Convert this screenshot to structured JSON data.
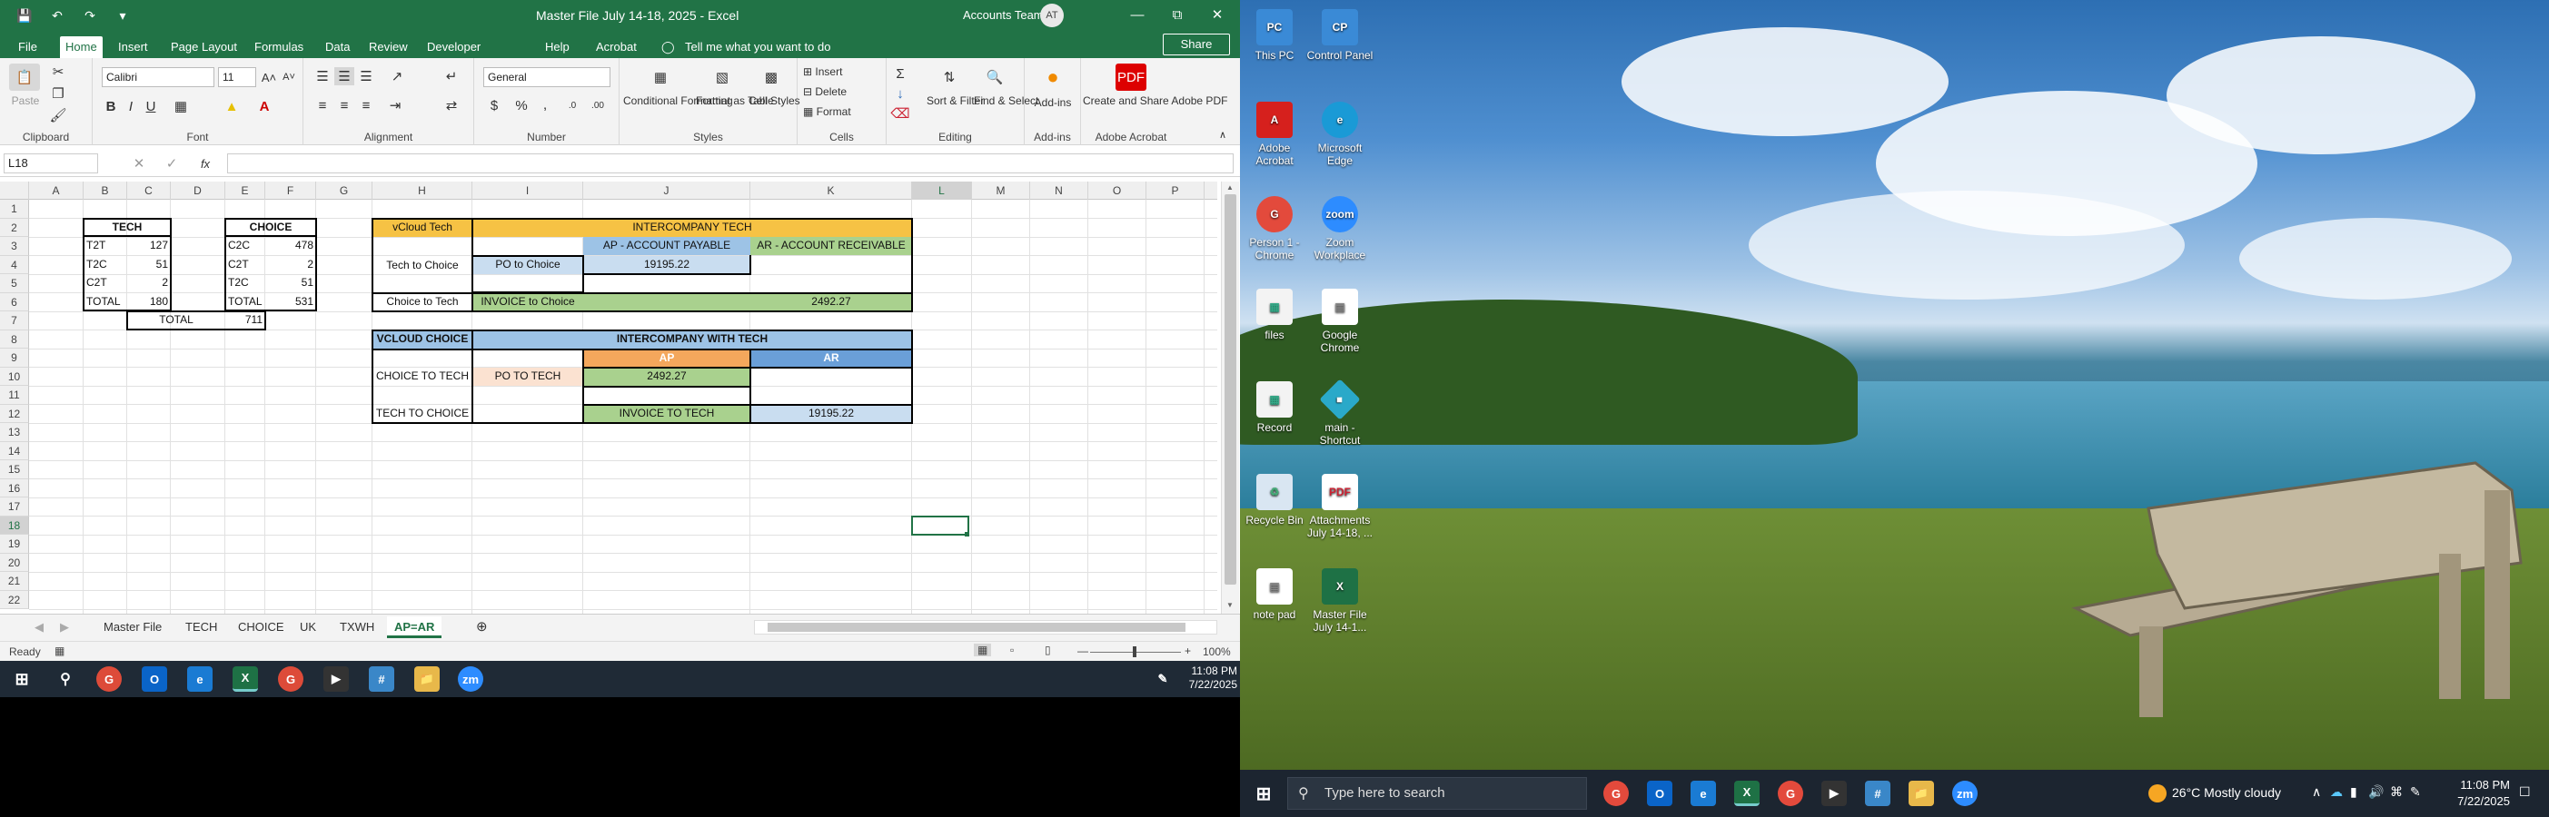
{
  "excel": {
    "title": "Master File July 14-18, 2025  -  Excel",
    "account": "Accounts Team",
    "avatar_initials": "AT",
    "share": "Share",
    "ribbon_tabs": [
      "File",
      "Home",
      "Insert",
      "Page Layout",
      "Formulas",
      "Data",
      "Review",
      "Developer",
      "Help",
      "Acrobat"
    ],
    "tell_me": "Tell me what you want to do",
    "ribbon": {
      "paste": "Paste",
      "clipboard": "Clipboard",
      "font_name": "Calibri",
      "font_size": "11",
      "font": "Font",
      "alignment": "Alignment",
      "number_format": "General",
      "number": "Number",
      "conditional": "Conditional Formatting",
      "format_table": "Format as Table",
      "cell_styles": "Cell Styles",
      "styles": "Styles",
      "insert": "Insert",
      "delete": "Delete",
      "format": "Format",
      "cells": "Cells",
      "sort_filter": "Sort & Filter",
      "find_select": "Find & Select",
      "editing": "Editing",
      "addins": "Add-ins",
      "addins_group": "Add-ins",
      "create_share": "Create and Share Adobe PDF",
      "adobe_acrobat": "Adobe Acrobat"
    },
    "name_box": "L18",
    "fx": "fx",
    "columns": [
      "A",
      "B",
      "C",
      "D",
      "E",
      "F",
      "G",
      "H",
      "I",
      "J",
      "K",
      "L",
      "M",
      "N",
      "O",
      "P"
    ],
    "rows": [
      "1",
      "2",
      "3",
      "4",
      "5",
      "6",
      "7",
      "8",
      "9",
      "10",
      "11",
      "12",
      "13",
      "14",
      "15",
      "16",
      "17",
      "18",
      "19",
      "20",
      "21",
      "22"
    ],
    "cells": {
      "tech_header": "TECH",
      "tech_rows": [
        [
          "T2T",
          "127"
        ],
        [
          "T2C",
          "51"
        ],
        [
          "C2T",
          "2"
        ],
        [
          "TOTAL",
          "180"
        ]
      ],
      "choice_header": "CHOICE",
      "choice_rows": [
        [
          "C2C",
          "478"
        ],
        [
          "C2T",
          "2"
        ],
        [
          "T2C",
          "51"
        ],
        [
          "TOTAL",
          "531"
        ]
      ],
      "total_label": "TOTAL",
      "total_value": "711",
      "vcloud_tech": "vCloud Tech",
      "intercompany_tech": "INTERCOMPANY TECH",
      "ap_payable": "AP - ACCOUNT PAYABLE",
      "ar_receivable": "AR - ACCOUNT RECEIVABLE",
      "tech_to_choice": "Tech to Choice",
      "po_to_choice": "PO to Choice",
      "v19195": "19195.22",
      "choice_to_tech": "Choice to Tech",
      "invoice_to_choice": "INVOICE to Choice",
      "v2492": "2492.27",
      "vcloud_choice": "VCLOUD CHOICE",
      "intercompany_with_tech": "INTERCOMPANY WITH TECH",
      "ap": "AP",
      "ar": "AR",
      "choice_to_tech_caps": "CHOICE TO TECH",
      "po_to_tech": "PO TO TECH",
      "v2492b": "2492.27",
      "tech_to_choice_caps": "TECH TO CHOICE",
      "invoice_to_tech": "INVOICE TO TECH",
      "v19195b": "19195.22"
    },
    "sheets": [
      "Master File",
      "TECH",
      "CHOICE",
      "UK",
      "TXWH",
      "AP=AR"
    ],
    "active_sheet": "AP=AR",
    "status": "Ready",
    "zoom": "100%",
    "clock_time": "11:08 PM",
    "clock_date": "7/22/2025"
  },
  "desktop": {
    "icons": [
      {
        "label": "This PC",
        "icon": "pc-icon"
      },
      {
        "label": "Control Panel",
        "icon": "control-panel-icon"
      },
      {
        "label": "Adobe Acrobat",
        "icon": "acrobat-icon"
      },
      {
        "label": "Microsoft Edge",
        "icon": "edge-icon"
      },
      {
        "label": "Person 1 - Chrome",
        "icon": "chrome-icon"
      },
      {
        "label": "Zoom Workplace",
        "icon": "zoom-icon"
      },
      {
        "label": "files",
        "icon": "files-icon"
      },
      {
        "label": "Google Chrome",
        "icon": "doc-icon"
      },
      {
        "label": "Record",
        "icon": "record-icon"
      },
      {
        "label": "main - Shortcut",
        "icon": "shortcut-icon"
      },
      {
        "label": "Recycle Bin",
        "icon": "recycle-bin-icon"
      },
      {
        "label": "Attachments July 14-18, ...",
        "icon": "attachments-icon"
      },
      {
        "label": "note pad",
        "icon": "notepad-icon"
      },
      {
        "label": "Master File July 14-1...",
        "icon": "excel-file-icon"
      }
    ],
    "search_placeholder": "Type here to search",
    "weather": "26°C  Mostly cloudy",
    "clock_time": "11:08 PM",
    "clock_date": "7/22/2025"
  }
}
